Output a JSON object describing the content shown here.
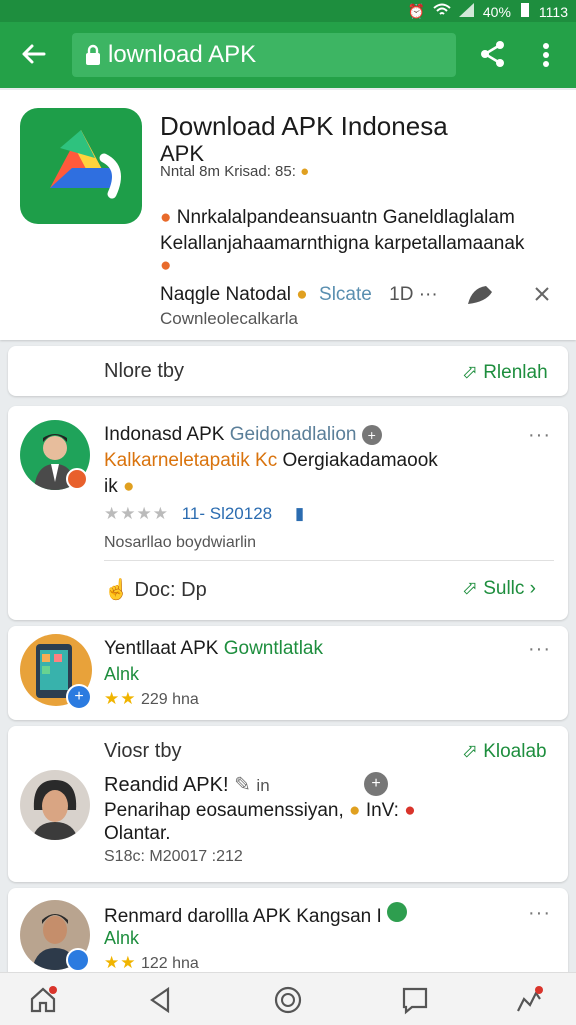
{
  "status": {
    "battery": "40%",
    "time": "1113"
  },
  "toolbar": {
    "url_text": "lownload APK"
  },
  "app": {
    "title": "Download APK Indonesa",
    "subtitle": "APK",
    "meta": "Nntal 8m Krisad: 85:",
    "desc_line1": "Nnrkalalpandeansuantn Ganeldlaglalam",
    "desc_line2": "Kelallanjahaamarnthigna karpetallamaanak",
    "author": "Naqgle Natodal",
    "rating": "Slcate",
    "count": "1D",
    "footer": "Cownleolecalkarla"
  },
  "more_by": {
    "label": "Nlore tby",
    "action": "Rlenlah"
  },
  "review1": {
    "name": "Indonasd APK",
    "name_accent": "Geidonadlalion",
    "line1_accent": "Kalkarneletapatik Kc",
    "line1": "Oergiakadamaook",
    "line2": "ik",
    "stars_text": "11- Sl20128",
    "sub": "Nosarllao boydwiarlin",
    "actions": "Doc: Dp",
    "action_right": "Sullc"
  },
  "item1": {
    "name": "Yentllaat APK",
    "name_accent": "Gowntlatlak",
    "sub": "Alnk",
    "stars_text": "229 hna"
  },
  "more_by2": {
    "label": "Viosr tby",
    "action": "Kloalab"
  },
  "item2": {
    "name": "Reandid APK!",
    "name_extra": "in",
    "line1": "Penarihap eosaumenssiyan,",
    "line1_end": "InV:",
    "line2": "Olantar.",
    "meta": "S18c: M20017 :212"
  },
  "item3": {
    "name": "Renmard darollla APK Kangsan I",
    "sub": "Alnk",
    "stars_text": "122 hna"
  },
  "colors": {
    "brand": "#24a148",
    "accent": "#1e8e3e",
    "orange": "#d9730d",
    "star": "#f0b400"
  }
}
